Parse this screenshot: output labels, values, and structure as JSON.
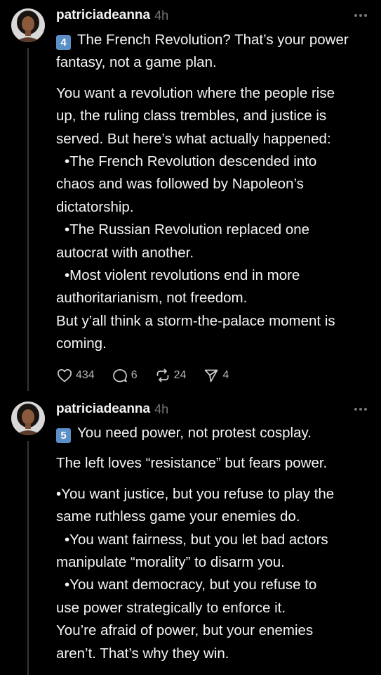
{
  "posts": [
    {
      "username": "patriciadeanna",
      "time": "4h",
      "keycap": "4",
      "headline": "The French Revolution? That’s your power fantasy, not a game plan.",
      "lines": [
        "You want a revolution where the people rise",
        "up, the ruling class trembles, and justice is",
        "served. But here’s what actually happened:",
        "•The French Revolution descended into",
        "chaos and was followed by Napoleon’s",
        "dictatorship.",
        "•The Russian Revolution replaced one",
        "autocrat with another.",
        "•Most violent revolutions end in more",
        "authoritarianism, not freedom.",
        "But y’all think a storm-the-palace moment is",
        "coming."
      ],
      "likes": "434",
      "replies": "6",
      "reposts": "24",
      "shares": "4"
    },
    {
      "username": "patriciadeanna",
      "time": "4h",
      "keycap": "5",
      "headline": "You need power, not protest cosplay.",
      "para1": "The left loves “resistance” but fears power.",
      "lines": [
        "•You want justice, but you refuse to play the",
        "same ruthless game your enemies do.",
        "•You want fairness, but you let bad actors",
        "manipulate “morality” to disarm you.",
        "•You want democracy, but you refuse to",
        "use power strategically to enforce it.",
        "You’re afraid of power, but your enemies",
        "aren’t. That’s why they win."
      ]
    }
  ]
}
